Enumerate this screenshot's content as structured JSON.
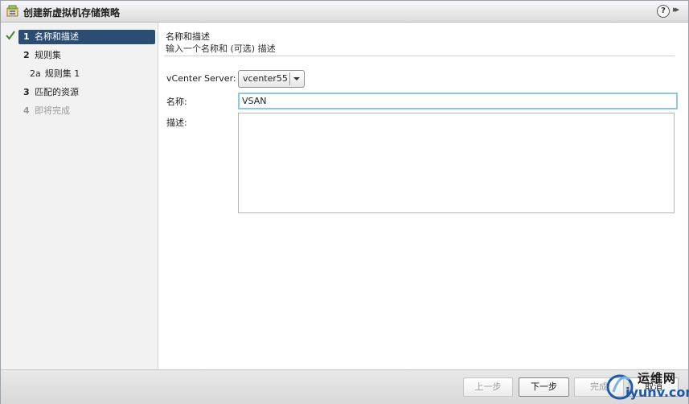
{
  "window": {
    "title": "创建新虚拟机存储策略"
  },
  "titlebar": {
    "help_label": "?",
    "expand_label": "▸▸"
  },
  "sidebar": {
    "steps": [
      {
        "num": "1",
        "label": "名称和描述"
      },
      {
        "num": "2",
        "label": "规则集"
      },
      {
        "num": "2a",
        "label": "规则集 1"
      },
      {
        "num": "3",
        "label": "匹配的资源"
      },
      {
        "num": "4",
        "label": "即将完成"
      }
    ]
  },
  "content": {
    "header_title": "名称和描述",
    "header_subtitle": "输入一个名称和 (可选) 描述",
    "vcenter_label": "vCenter Server:",
    "vcenter_value": "vcenter55",
    "name_label": "名称:",
    "name_value": "VSAN",
    "desc_label": "描述:",
    "desc_value": ""
  },
  "footer": {
    "back": "上一步",
    "next": "下一步",
    "finish": "完成",
    "cancel": "取消"
  },
  "watermark": {
    "line1": "运维网",
    "line2": "iyunv.com"
  },
  "colors": {
    "active_step": "#2c4d73",
    "focus_border": "#8cc8e6",
    "check": "#3f8a2e"
  }
}
